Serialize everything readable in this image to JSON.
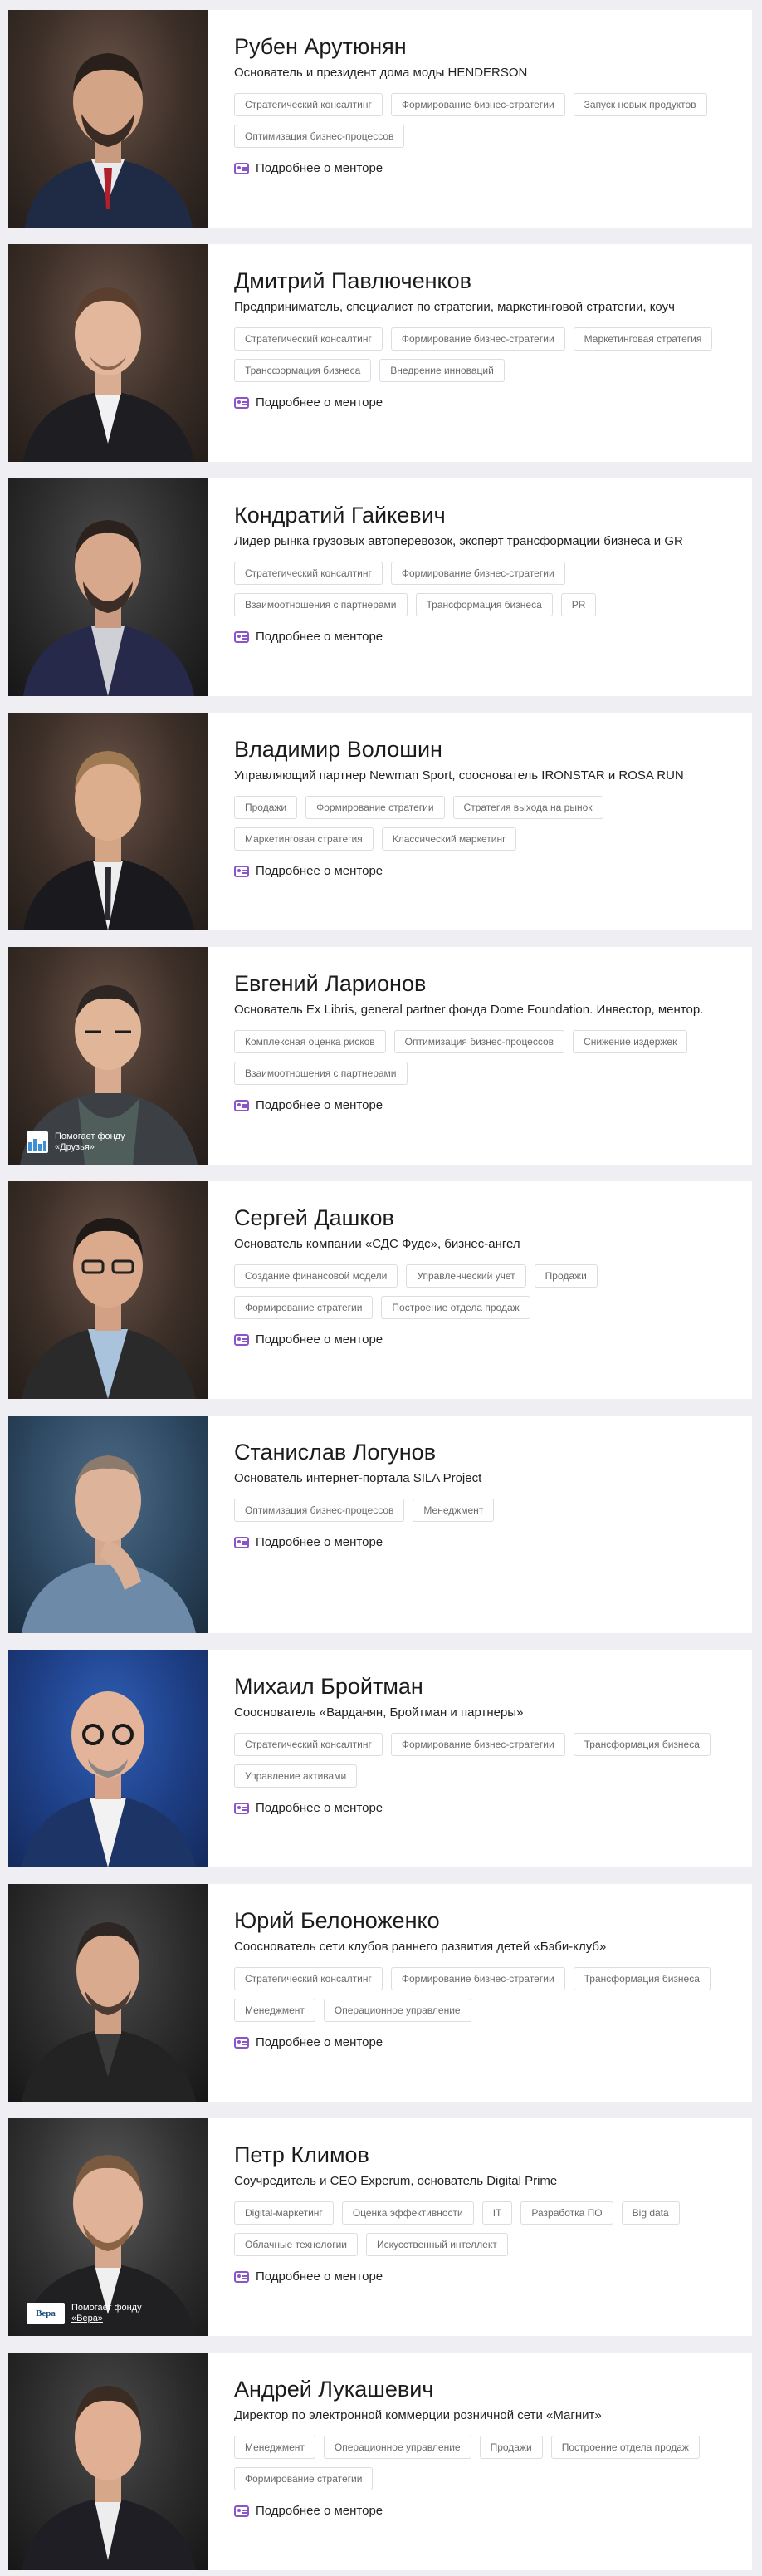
{
  "mentors": [
    {
      "name": "Рубен Арутюнян",
      "role": "Основатель и президент дома моды HENDERSON",
      "tags": [
        "Стратегический консалтинг",
        "Формирование бизнес-стратегии",
        "Запуск новых продуктов",
        "Оптимизация бизнес-процессов"
      ],
      "more": "Подробнее о менторе"
    },
    {
      "name": "Дмитрий Павлюченков",
      "role": "Предприниматель, специалист по стратегии, маркетинговой стратегии, коуч",
      "tags": [
        "Стратегический консалтинг",
        "Формирование бизнес-стратегии",
        "Маркетинговая стратегия",
        "Трансформация бизнеса",
        "Внедрение инноваций"
      ],
      "more": "Подробнее о менторе"
    },
    {
      "name": "Кондратий Гайкевич",
      "role": "Лидер рынка грузовых автоперевозок, эксперт трансформации бизнеса и GR",
      "tags": [
        "Стратегический консалтинг",
        "Формирование бизнес-стратегии",
        "Взаимоотношения с партнерами",
        "Трансформация бизнеса",
        "PR"
      ],
      "more": "Подробнее о менторе"
    },
    {
      "name": "Владимир Волошин",
      "role": "Управляющий партнер Newman Sport, сооснователь IRONSTAR и ROSA RUN",
      "tags": [
        "Продажи",
        "Формирование стратегии",
        "Стратегия выхода на рынок",
        "Маркетинговая стратегия",
        "Классический маркетинг"
      ],
      "more": "Подробнее о менторе"
    },
    {
      "name": "Евгений Ларионов",
      "role": "Основатель Ex Libris, general partner фонда Dome Foundation. Инвестор, ментор.",
      "tags": [
        "Комплексная оценка рисков",
        "Оптимизация бизнес-процессов",
        "Снижение издержек",
        "Взаимоотношения с партнерами"
      ],
      "more": "Подробнее о менторе",
      "charity": {
        "line1": "Помогает фонду",
        "line2": "«Друзья»"
      }
    },
    {
      "name": "Сергей Дашков",
      "role": "Основатель компании «СДС Фудс», бизнес-ангел",
      "tags": [
        "Создание финансовой модели",
        "Управленческий учет",
        "Продажи",
        "Формирование стратегии",
        "Построение отдела продаж"
      ],
      "more": "Подробнее о менторе"
    },
    {
      "name": "Станислав Логунов",
      "role": "Основатель интернет-портала SILA Project",
      "tags": [
        "Оптимизация бизнес-процессов",
        "Менеджмент"
      ],
      "more": "Подробнее о менторе"
    },
    {
      "name": "Михаил Бройтман",
      "role": "Сооснователь «Варданян, Бройтман и партнеры»",
      "tags": [
        "Стратегический консалтинг",
        "Формирование бизнес-стратегии",
        "Трансформация бизнеса",
        "Управление активами"
      ],
      "more": "Подробнее о менторе"
    },
    {
      "name": "Юрий Белоноженко",
      "role": "Сооснователь сети клубов раннего развития детей «Бэби-клуб»",
      "tags": [
        "Стратегический консалтинг",
        "Формирование бизнес-стратегии",
        "Трансформация бизнеса",
        "Менеджмент",
        "Операционное управление"
      ],
      "more": "Подробнее о менторе"
    },
    {
      "name": "Петр Климов",
      "role": "Соучредитель и CEO Experum, основатель Digital Prime",
      "tags": [
        "Digital-маркетинг",
        "Оценка эффективности",
        "IT",
        "Разработка ПО",
        "Big data",
        "Облачные технологии",
        "Искусственный интеллект"
      ],
      "more": "Подробнее о менторе",
      "charity": {
        "line1": "Помогает фонду",
        "line2": "«Вера»",
        "logo": "Вера"
      }
    },
    {
      "name": "Андрей Лукашевич",
      "role": "Директор по электронной коммерции розничной сети «Магнит»",
      "tags": [
        "Менеджмент",
        "Операционное управление",
        "Продажи",
        "Построение отдела продаж",
        "Формирование стратегии"
      ],
      "more": "Подробнее о менторе"
    }
  ]
}
